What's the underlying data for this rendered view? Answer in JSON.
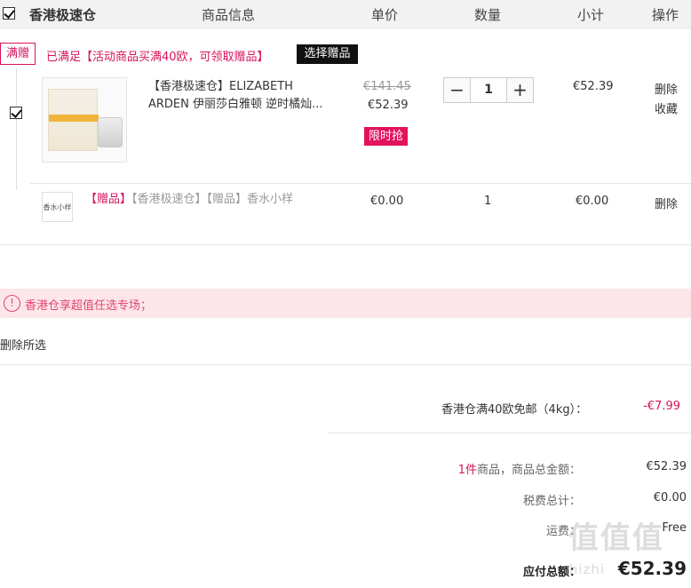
{
  "header": {
    "store_name": "香港极速仓",
    "col_product": "商品信息",
    "col_price": "单价",
    "col_qty": "数量",
    "col_subtotal": "小计",
    "col_action": "操作"
  },
  "promo": {
    "tag": "满赠",
    "text": "已满足【活动商品买满40欧，可领取赠品】",
    "select_gift": "选择赠品"
  },
  "item": {
    "image_alt": "ELIZABETH ARDEN",
    "name": "【香港极速仓】ELIZABETH ARDEN 伊丽莎白雅顿 逆时橘灿...",
    "old_price": "€141.45",
    "price": "€52.39",
    "flash_tag": "限时抢",
    "qty_minus": "−",
    "qty": "1",
    "qty_plus": "+",
    "subtotal": "€52.39",
    "delete": "删除",
    "favorite": "收藏"
  },
  "gift": {
    "thumb_text": "香水小样",
    "tag": "【赠品】",
    "name": "【香港极速仓】【赠品】香水小样",
    "price": "€0.00",
    "qty": "1",
    "subtotal": "€0.00",
    "delete": "删除"
  },
  "notice": {
    "icon": "!",
    "text": "香港仓享超值任选专场；"
  },
  "actions": {
    "delete_selected": "删除所选"
  },
  "summary": {
    "shipping_label": "香港仓满40欧免邮（4kg）：",
    "shipping_value": "-€7.99",
    "count": "1件",
    "total_label": "商品，商品总金额：",
    "total_value": "€52.39",
    "tax_label": "税费总计：",
    "tax_value": "€0.00",
    "freight_label": "运费：",
    "freight_value": "Free",
    "payable_label": "应付总额：",
    "payable_value": "€52.39"
  },
  "watermark": {
    "main": "值值值",
    "sub": "zhizhi"
  },
  "colors": {
    "accent": "#d6135c",
    "header_bg": "#f2f2f2",
    "notice_bg": "#fde6ea"
  }
}
